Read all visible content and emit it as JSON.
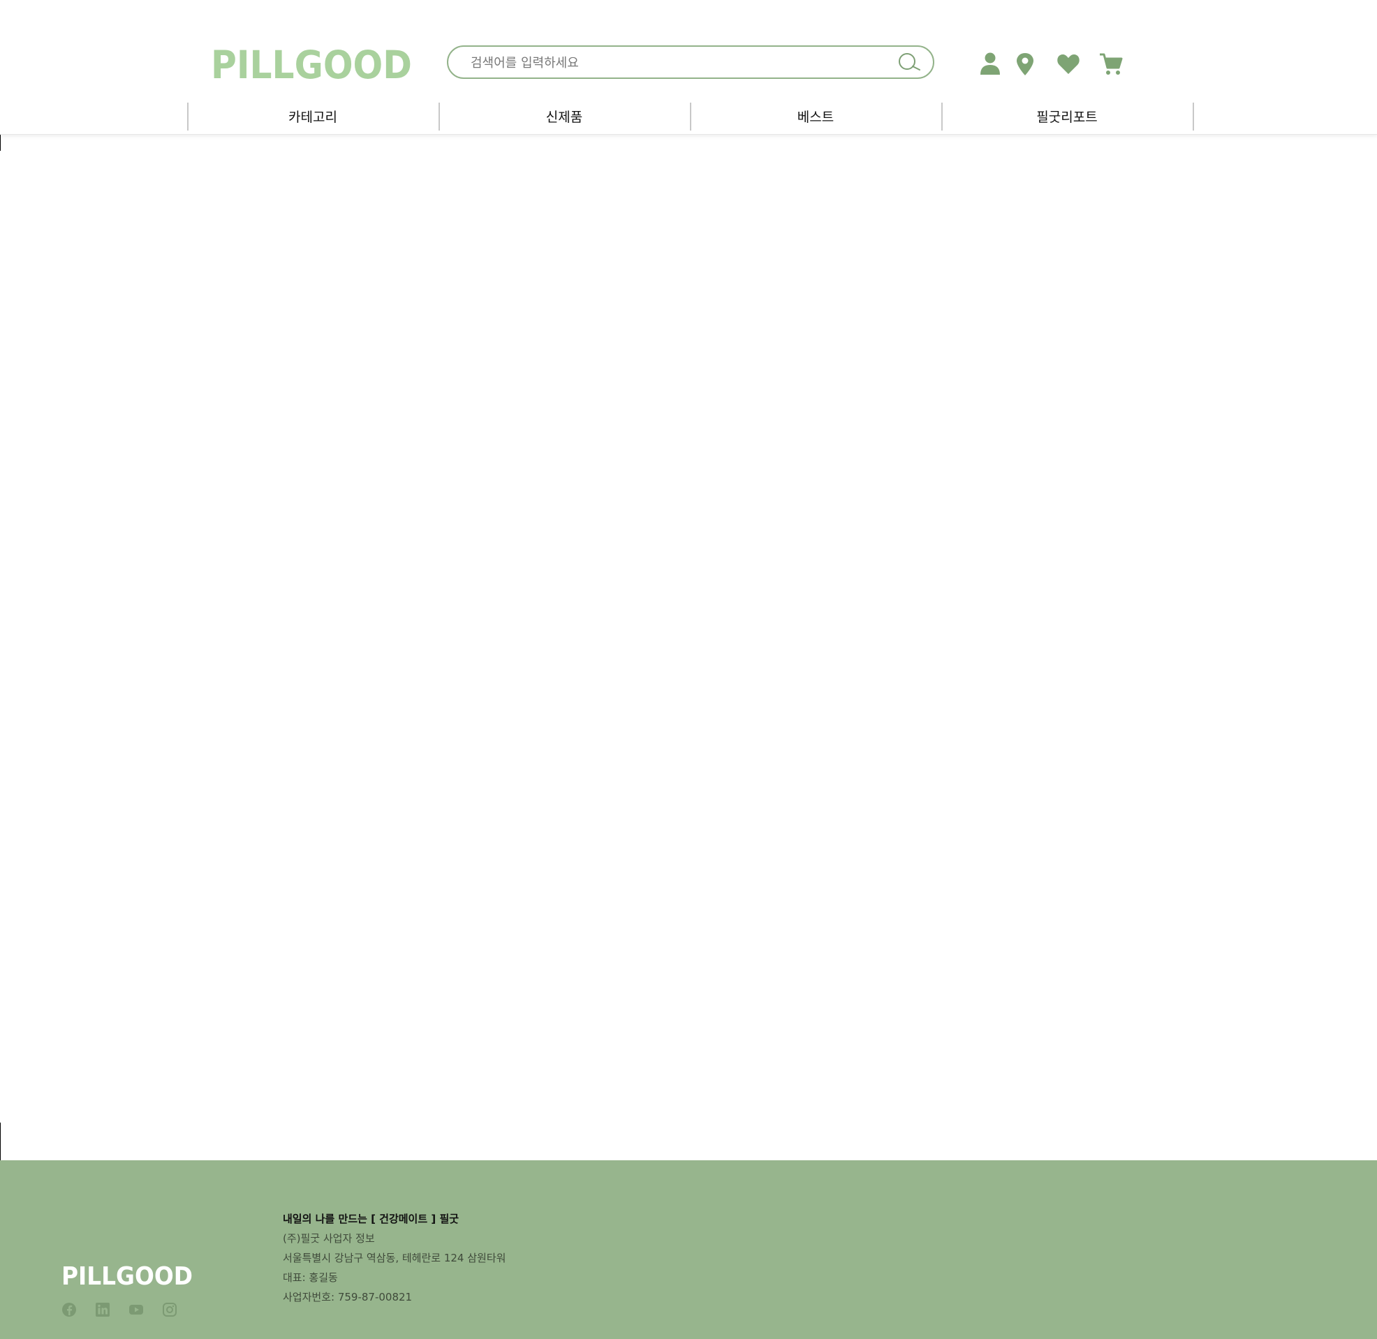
{
  "header": {
    "logo_text": "PILLGOOD",
    "search": {
      "placeholder": "검색어를 입력하세요"
    },
    "util_icons": [
      "user-icon",
      "location-pin-icon",
      "heart-icon",
      "cart-icon"
    ],
    "nav": [
      {
        "label": "카테고리"
      },
      {
        "label": "신제품"
      },
      {
        "label": "베스트"
      },
      {
        "label": "필굿리포트"
      }
    ]
  },
  "footer": {
    "logo_text": "PILLGOOD",
    "tagline": "내일의 나를 만드는 [ 건강메이트 ] 필굿",
    "company_info": "(주)필굿 사업자 정보",
    "address": "서울특별시 강남구 역삼동, 테헤란로 124 삼원타워",
    "ceo": "대표: 홍길동",
    "business_number": "사업자번호: 759-87-00821",
    "social_icons": [
      "facebook-icon",
      "linkedin-icon",
      "youtube-icon",
      "instagram-icon"
    ]
  },
  "colors": {
    "brand_light": "#a9d19d",
    "brand": "#93b38a",
    "footer_bg": "#97b58d"
  }
}
